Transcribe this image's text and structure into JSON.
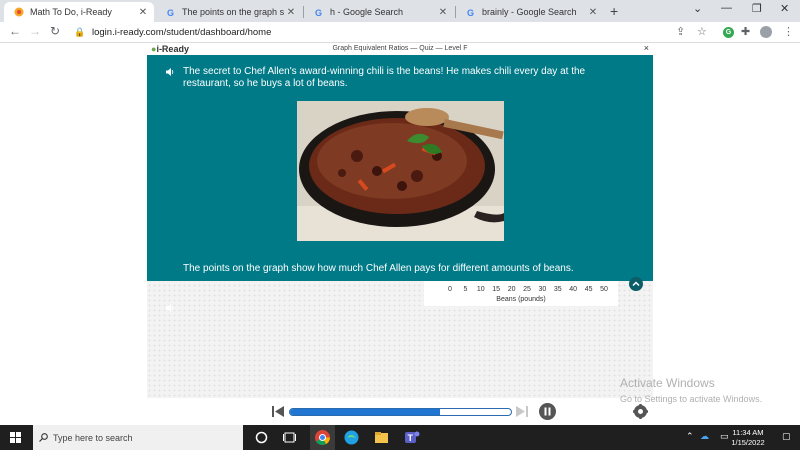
{
  "browser": {
    "tabs": [
      {
        "title": "Math To Do, i-Ready",
        "favicon": "iready-icon",
        "active": true
      },
      {
        "title": "The points on the graph show th",
        "favicon": "google-icon",
        "active": false
      },
      {
        "title": "h - Google Search",
        "favicon": "google-icon",
        "active": false
      },
      {
        "title": "brainly - Google Search",
        "favicon": "google-icon",
        "active": false
      }
    ],
    "new_tab": "+",
    "url": "login.i-ready.com/student/dashboard/home",
    "profile_initial": "G"
  },
  "quiz": {
    "logo": "i-Ready",
    "header_title": "Graph Equivalent Ratios — Quiz — Level F",
    "close": "×",
    "intro_text": "The secret to Chef Allen's award-winning chili is the beans! He makes chili every day at the restaurant, so he buys a lot of beans.",
    "question_text": "The points on the graph show how much Chef Allen pays for different amounts of beans.",
    "graph": {
      "x_ticks": [
        "0",
        "5",
        "10",
        "15",
        "20",
        "25",
        "30",
        "35",
        "40",
        "45",
        "50"
      ],
      "x_label": "Beans (pounds)"
    },
    "progress": 0.68
  },
  "watermark": {
    "title": "Activate Windows",
    "subtitle": "Go to Settings to activate Windows."
  },
  "taskbar": {
    "search_placeholder": "Type here to search",
    "time": "11:34 AM",
    "date": "1/15/2022"
  },
  "colors": {
    "teal": "#007a87",
    "progress": "#2176d2",
    "taskbar": "#1f1f1f"
  }
}
